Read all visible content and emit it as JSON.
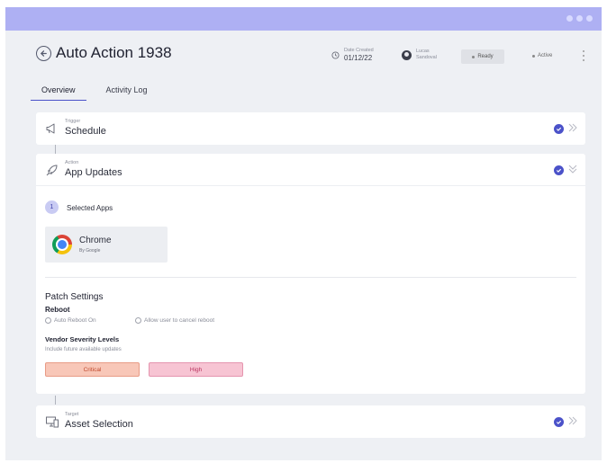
{
  "header": {
    "title": "Auto Action 1938",
    "date_label": "Date Created",
    "date_value": "01/12/22",
    "user_first": "Lucas",
    "user_last": "Sandoval",
    "status_label": "Ready",
    "state_label": "Active"
  },
  "tabs": [
    {
      "label": "Overview",
      "active": true
    },
    {
      "label": "Activity Log",
      "active": false
    }
  ],
  "trigger": {
    "small": "Trigger",
    "title": "Schedule"
  },
  "action": {
    "small": "Action",
    "title": "App Updates",
    "step_number": "1",
    "step_label": "Selected Apps",
    "app": {
      "name": "Chrome",
      "vendor": "By Google"
    },
    "patch": {
      "title": "Patch Settings",
      "reboot_title": "Reboot",
      "reboot_opt1": "Auto Reboot On",
      "reboot_opt2": "Allow user to cancel reboot",
      "severity_title": "Vendor Severity Levels",
      "severity_sub": "Include future available updates",
      "critical_label": "Critical",
      "high_label": "High"
    }
  },
  "target": {
    "small": "Target",
    "title": "Asset Selection"
  },
  "colors": {
    "topbar": "#aeb0f3",
    "accent": "#4b52c9",
    "critical": "#f8c7b8",
    "high": "#f7c4d3"
  }
}
